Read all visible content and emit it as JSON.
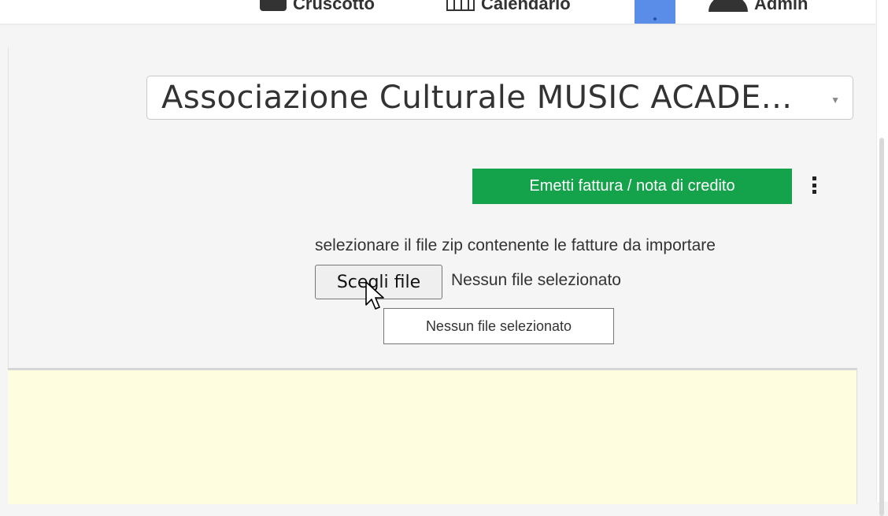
{
  "topbar": {
    "dashboard_label": "Cruscotto",
    "calendar_label": "Calendario",
    "user_label": "Admin"
  },
  "company_select": {
    "value": "Associazione Culturale MUSIC ACADE...",
    "caret": "▼"
  },
  "actions": {
    "emit_label": "Emetti fattura / nota di credito"
  },
  "import": {
    "label": "selezionare il file zip contenente le fatture da importare",
    "choose_button": "Scegli file",
    "status": "Nessun file selezionato",
    "tooltip": "Nessun file selezionato"
  },
  "colors": {
    "emit_button": "#14a24a",
    "panel": "#fffde0",
    "blue_button": "#5a8de8"
  }
}
